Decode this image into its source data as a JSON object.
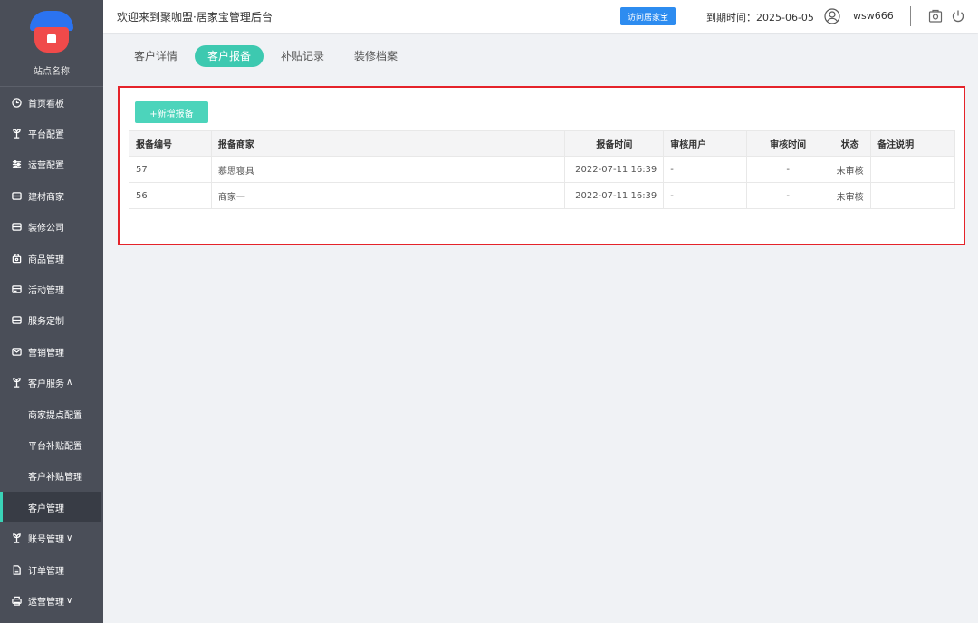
{
  "sidebar": {
    "site_name": "站点名称",
    "items": [
      {
        "label": "首页看板",
        "icon": "clock-icon"
      },
      {
        "label": "平台配置",
        "icon": "plant-icon"
      },
      {
        "label": "运营配置",
        "icon": "sliders-icon"
      },
      {
        "label": "建材商家",
        "icon": "box-icon"
      },
      {
        "label": "装修公司",
        "icon": "box-icon"
      },
      {
        "label": "商品管理",
        "icon": "bag-icon"
      },
      {
        "label": "活动管理",
        "icon": "card-icon"
      },
      {
        "label": "服务定制",
        "icon": "box-icon"
      },
      {
        "label": "营销管理",
        "icon": "mail-icon"
      },
      {
        "label": "客户服务",
        "icon": "plant-icon",
        "arrow": "∧"
      }
    ],
    "sub_items": [
      {
        "label": "商家提点配置"
      },
      {
        "label": "平台补贴配置"
      },
      {
        "label": "客户补贴管理"
      },
      {
        "label": "客户管理"
      }
    ],
    "items_after": [
      {
        "label": "账号管理",
        "icon": "plant-icon",
        "arrow": "∨"
      },
      {
        "label": "订单管理",
        "icon": "doc-icon"
      },
      {
        "label": "运营管理",
        "icon": "print-icon",
        "arrow": "∨"
      }
    ]
  },
  "header": {
    "welcome": "欢迎来到聚咖盟·居家宝管理后台",
    "visit_button": "访问居家宝",
    "expire": "到期时间：2025-06-05",
    "username": "wsw666"
  },
  "tabs": [
    {
      "label": "客户详情"
    },
    {
      "label": "客户报备"
    },
    {
      "label": "补贴记录"
    },
    {
      "label": "装修档案"
    }
  ],
  "panel": {
    "add_button": "+新增报备",
    "columns": [
      "报备编号",
      "报备商家",
      "报备时间",
      "审核用户",
      "审核时间",
      "状态",
      "备注说明"
    ],
    "rows": [
      [
        "57",
        "慕思寝具",
        "2022-07-11 16:39",
        "-",
        "-",
        "未审核",
        ""
      ],
      [
        "56",
        "商家一",
        "2022-07-11 16:39",
        "-",
        "-",
        "未审核",
        ""
      ]
    ]
  },
  "colors": {
    "sidebar_bg": "#4a4e58",
    "accent": "#3dc9b0",
    "primary_button": "#2d8cf0",
    "highlight_border": "#e5232a"
  }
}
